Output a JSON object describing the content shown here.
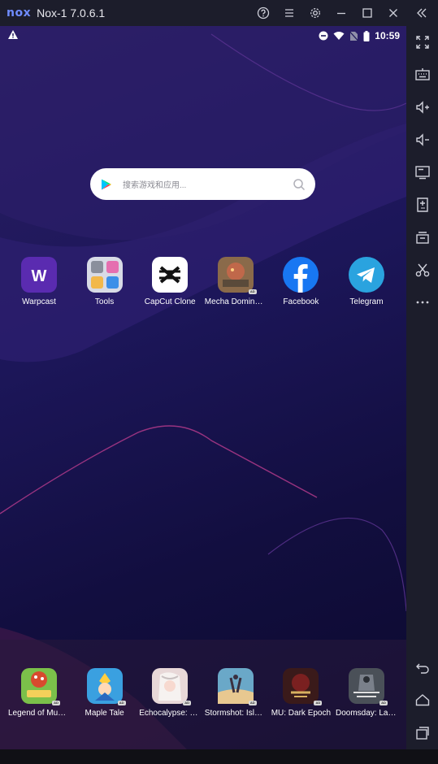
{
  "window": {
    "logo_text": "nox",
    "title": "Nox-1 7.0.6.1",
    "buttons": [
      "help-icon",
      "menu-icon",
      "settings-icon",
      "minimize-icon",
      "maximize-icon",
      "close-icon",
      "collapse-sidebar-icon"
    ]
  },
  "statusbar": {
    "time": "10:59",
    "icons": [
      "warning-icon",
      "do-not-disturb-icon",
      "wifi-icon",
      "no-sim-icon",
      "battery-icon"
    ]
  },
  "search": {
    "placeholder": "搜索游戏和应用..."
  },
  "home_apps": [
    {
      "label": "Warpcast",
      "icon": "warpcast-icon",
      "color": "#5a2bb0"
    },
    {
      "label": "Tools",
      "icon": "tools-folder-icon",
      "color": "#d8dbe6"
    },
    {
      "label": "CapCut Clone",
      "icon": "capcut-icon",
      "color": "#ffffff"
    },
    {
      "label": "Mecha Domina…",
      "icon": "mecha-domination-icon",
      "color": "#8a6a4a",
      "ad": "AD"
    },
    {
      "label": "Facebook",
      "icon": "facebook-icon",
      "color": "#1877f2"
    },
    {
      "label": "Telegram",
      "icon": "telegram-icon",
      "color": "#2aa3df"
    }
  ],
  "dock_apps": [
    {
      "label": "Legend of Mus…",
      "icon": "legend-of-mushroom-icon",
      "color": "#d84a2e",
      "ad": "AD"
    },
    {
      "label": "Maple Tale",
      "icon": "maple-tale-icon",
      "color": "#3aa0e0",
      "ad": "AD"
    },
    {
      "label": "Echocalypse: S…",
      "icon": "echocalypse-icon",
      "color": "#e8d8d8",
      "ad": "AD"
    },
    {
      "label": "Stormshot: Isle…",
      "icon": "stormshot-icon",
      "color": "#6aa8c8",
      "ad": "AD"
    },
    {
      "label": "MU: Dark Epoch",
      "icon": "mu-dark-epoch-icon",
      "color": "#3a1a1a",
      "ad": "AD"
    },
    {
      "label": "Doomsday: Las…",
      "icon": "doomsday-icon",
      "color": "#4a5058",
      "ad": "AD"
    }
  ],
  "sidebar": {
    "tools": [
      "fullscreen-icon",
      "keyboard-icon",
      "volume-up-icon",
      "volume-down-icon",
      "screen-icon",
      "apk-install-icon",
      "multi-instance-icon",
      "scissors-icon",
      "more-icon"
    ],
    "nav": [
      "back-icon",
      "home-icon",
      "recents-icon"
    ]
  }
}
